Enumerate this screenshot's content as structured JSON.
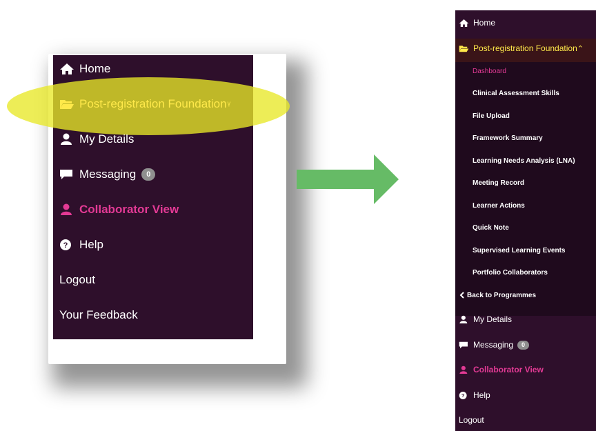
{
  "colors": {
    "menu_bg": "#2e0f2b",
    "submenu_bg": "#1f0a1d",
    "accent_pink": "#e33a95",
    "highlight_yellow": "#ffe94a",
    "arrow_green": "#66bb66",
    "badge_grey": "#8f8f8f"
  },
  "left_menu": {
    "items": [
      {
        "label": "Home",
        "icon": "home-icon"
      },
      {
        "label": "Post-registration Foundation",
        "icon": "folder-open-icon",
        "chevron": "ᵞ"
      },
      {
        "label": "My Details",
        "icon": "user-icon"
      },
      {
        "label": "Messaging",
        "icon": "comment-icon",
        "badge": "0"
      },
      {
        "label": "Collaborator View",
        "icon": "user-icon"
      },
      {
        "label": "Help",
        "icon": "question-circle-icon"
      },
      {
        "label": "Logout"
      },
      {
        "label": "Your Feedback"
      }
    ]
  },
  "right_menu": {
    "home": "Home",
    "programme": "Post-registration Foundation",
    "programme_chevron": "⌃",
    "submenu": [
      "Dashboard",
      "Clinical Assessment Skills",
      "File Upload",
      "Framework Summary",
      "Learning Needs Analysis (LNA)",
      "Meeting Record",
      "Learner Actions",
      "Quick Note",
      "Supervised Learning Events",
      "Portfolio Collaborators"
    ],
    "back": "Back to Programmes",
    "items": [
      {
        "label": "My Details",
        "icon": "user-icon"
      },
      {
        "label": "Messaging",
        "icon": "comment-icon",
        "badge": "0"
      },
      {
        "label": "Collaborator View",
        "icon": "user-icon"
      },
      {
        "label": "Help",
        "icon": "question-circle-icon"
      },
      {
        "label": "Logout"
      }
    ]
  }
}
